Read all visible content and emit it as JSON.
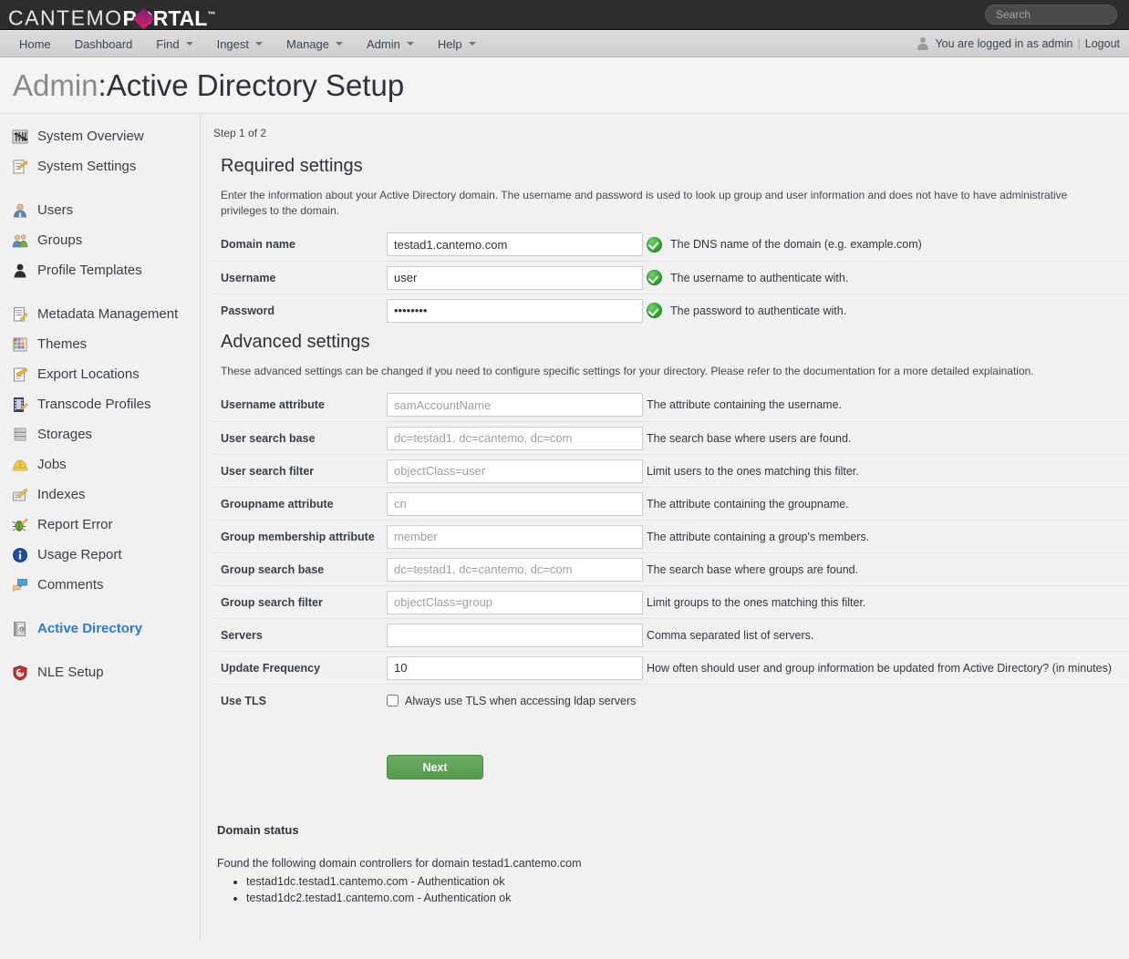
{
  "header": {
    "logo": {
      "part1": "CANTEMO",
      "part2_pre": "P",
      "part2_o": "O",
      "part2_post": "RTAL",
      "tm": "™"
    },
    "search": {
      "placeholder": "Search",
      "value": ""
    }
  },
  "nav": {
    "items": [
      {
        "label": "Home",
        "caret": false
      },
      {
        "label": "Dashboard",
        "caret": false
      },
      {
        "label": "Find",
        "caret": true
      },
      {
        "label": "Ingest",
        "caret": true
      },
      {
        "label": "Manage",
        "caret": true
      },
      {
        "label": "Admin",
        "caret": true
      },
      {
        "label": "Help",
        "caret": true
      }
    ],
    "logged_in_text": "You are logged in as admin",
    "separator": "|",
    "logout_label": "Logout"
  },
  "page": {
    "title_prefix": "Admin",
    "title_sep": ": ",
    "title_main": "Active Directory Setup"
  },
  "sidebar": {
    "groups": [
      {
        "items": [
          {
            "label": "System Overview",
            "icon": "sliders-icon",
            "active": false
          },
          {
            "label": "System Settings",
            "icon": "settings-document-icon",
            "active": false
          }
        ]
      },
      {
        "items": [
          {
            "label": "Users",
            "icon": "user-icon",
            "active": false
          },
          {
            "label": "Groups",
            "icon": "users-group-icon",
            "active": false
          },
          {
            "label": "Profile Templates",
            "icon": "profile-silhouette-icon",
            "active": false
          }
        ]
      },
      {
        "items": [
          {
            "label": "Metadata Management",
            "icon": "metadata-document-icon",
            "active": false
          },
          {
            "label": "Themes",
            "icon": "palette-grid-icon",
            "active": false
          },
          {
            "label": "Export Locations",
            "icon": "export-document-icon",
            "active": false
          },
          {
            "label": "Transcode Profiles",
            "icon": "film-strip-icon",
            "active": false
          },
          {
            "label": "Storages",
            "icon": "database-stack-icon",
            "active": false
          },
          {
            "label": "Jobs",
            "icon": "hardhat-icon",
            "active": false
          },
          {
            "label": "Indexes",
            "icon": "index-pencil-icon",
            "active": false
          },
          {
            "label": "Report Error",
            "icon": "bug-icon",
            "active": false
          },
          {
            "label": "Usage Report",
            "icon": "info-circle-icon",
            "active": false
          },
          {
            "label": "Comments",
            "icon": "speech-bubbles-icon",
            "active": false
          }
        ]
      },
      {
        "items": [
          {
            "label": "Active Directory",
            "icon": "address-book-icon",
            "active": true
          }
        ]
      },
      {
        "items": [
          {
            "label": "NLE Setup",
            "icon": "shield-icon",
            "active": false
          }
        ]
      }
    ]
  },
  "main": {
    "step": "Step 1 of 2",
    "required": {
      "title": "Required settings",
      "description": "Enter the information about your Active Directory domain. The username and password is used to look up group and user information and does not have to have administrative privileges to the domain.",
      "rows": [
        {
          "label": "Domain name",
          "type": "text",
          "value": "testad1.cantemo.com",
          "ghost": false,
          "ok": true,
          "help": "The DNS name of the domain (e.g. example.com)"
        },
        {
          "label": "Username",
          "type": "text",
          "value": "user",
          "ghost": false,
          "ok": true,
          "help": "The username to authenticate with."
        },
        {
          "label": "Password",
          "type": "password",
          "value": "password",
          "ghost": false,
          "ok": true,
          "help": "The password to authenticate with."
        }
      ]
    },
    "advanced": {
      "title": "Advanced settings",
      "description": "These advanced settings can be changed if you need to configure specific settings for your directory. Please refer to the documentation for a more detailed explaination.",
      "rows": [
        {
          "label": "Username attribute",
          "type": "text",
          "value": "samAccountName",
          "ghost": true,
          "ok": false,
          "help": "The attribute containing the username."
        },
        {
          "label": "User search base",
          "type": "text",
          "value": "dc=testad1, dc=cantemo, dc=com",
          "ghost": true,
          "ok": false,
          "help": "The search base where users are found."
        },
        {
          "label": "User search filter",
          "type": "text",
          "value": "objectClass=user",
          "ghost": true,
          "ok": false,
          "help": "Limit users to the ones matching this filter."
        },
        {
          "label": "Groupname attribute",
          "type": "text",
          "value": "cn",
          "ghost": true,
          "ok": false,
          "help": "The attribute containing the groupname."
        },
        {
          "label": "Group membership attribute",
          "type": "text",
          "value": "member",
          "ghost": true,
          "ok": false,
          "help": "The attribute containing a group's members."
        },
        {
          "label": "Group search base",
          "type": "text",
          "value": "dc=testad1, dc=cantemo, dc=com",
          "ghost": true,
          "ok": false,
          "help": "The search base where groups are found."
        },
        {
          "label": "Group search filter",
          "type": "text",
          "value": "objectClass=group",
          "ghost": true,
          "ok": false,
          "help": "Limit groups to the ones matching this filter."
        },
        {
          "label": "Servers",
          "type": "text",
          "value": "",
          "ghost": true,
          "ok": false,
          "help": "Comma separated list of servers."
        },
        {
          "label": "Update Frequency",
          "type": "text",
          "value": "10",
          "ghost": false,
          "ok": false,
          "help": "How often should user and group information be updated from Active Directory? (in minutes)"
        }
      ],
      "tls": {
        "label": "Use TLS",
        "checkbox_label": "Always use TLS when accessing ldap servers",
        "checked": false
      }
    },
    "next_label": "Next",
    "status": {
      "title": "Domain status",
      "lead": "Found the following domain controllers for domain testad1.cantemo.com",
      "items": [
        "testad1dc.testad1.cantemo.com - Authentication ok",
        "testad1dc2.testad1.cantemo.com - Authentication ok"
      ]
    }
  },
  "colors": {
    "topbar": "#2b2b2b",
    "navbar": "#d4d4d4",
    "accent_blue": "#2b7bd6",
    "ok_green": "#34a834",
    "button_green": "#559c4e",
    "logo_magenta": "#e0225c"
  }
}
